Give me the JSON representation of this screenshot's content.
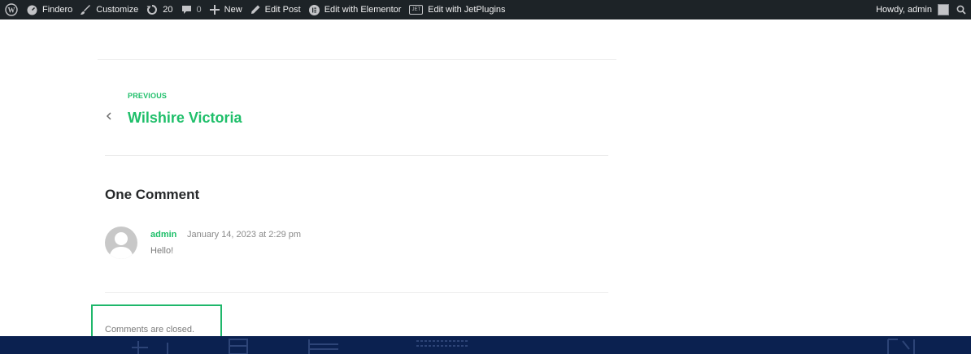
{
  "adminbar": {
    "site_name": "Findero",
    "customize": "Customize",
    "updates_count": "20",
    "comments_count": "0",
    "new_label": "New",
    "edit_post": "Edit Post",
    "edit_elementor": "Edit with Elementor",
    "jet_icon_text": "JET",
    "edit_jetplugins": "Edit with JetPlugins",
    "howdy": "Howdy, admin"
  },
  "post_nav": {
    "previous_label": "PREVIOUS",
    "previous_title": "Wilshire Victoria"
  },
  "comments": {
    "title": "One Comment",
    "items": [
      {
        "author": "admin",
        "date": "January 14, 2023 at 2:29 pm",
        "text": "Hello!"
      }
    ],
    "closed_text": "Comments are closed."
  },
  "colors": {
    "accent": "#1fbf6a",
    "adminbar_bg": "#1d2327",
    "footer_bg": "#0b2150",
    "highlight": "#1fb76b"
  }
}
